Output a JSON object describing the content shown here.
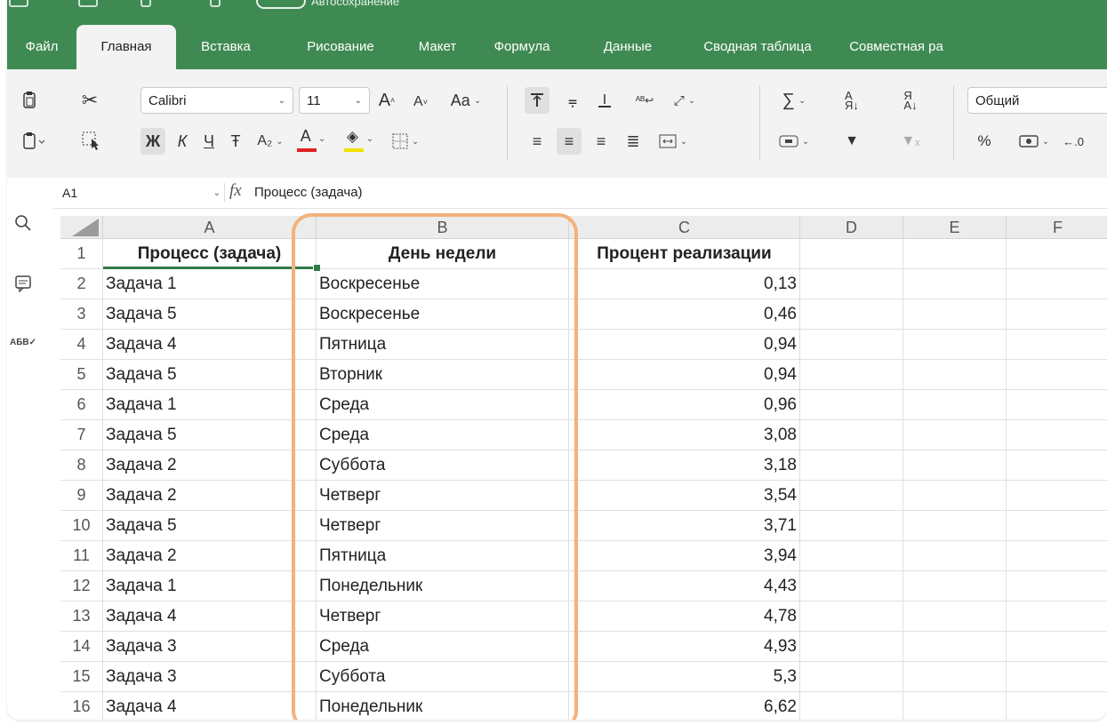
{
  "title_bar": {
    "autosave_label": "Автосохранение"
  },
  "ribbon_tabs": [
    {
      "label": "Файл",
      "active": false
    },
    {
      "label": "Главная",
      "active": true
    },
    {
      "label": "Вставка",
      "active": false
    },
    {
      "label": "Рисование",
      "active": false
    },
    {
      "label": "Макет",
      "active": false
    },
    {
      "label": "Формула",
      "active": false
    },
    {
      "label": "Данные",
      "active": false
    },
    {
      "label": "Сводная таблица",
      "active": false
    },
    {
      "label": "Совместная ра",
      "active": false
    }
  ],
  "ribbon": {
    "font_name": "Calibri",
    "font_size": "11",
    "bold_label": "Ж",
    "italic_label": "К",
    "underline_label": "Ч",
    "number_format": "Общий",
    "percent_label": "%",
    "font_color": "#e02020",
    "fill_color": "#f2e200"
  },
  "formula_bar": {
    "name_box": "A1",
    "fx_label": "fx",
    "value": "Процесс (задача)"
  },
  "grid": {
    "columns": [
      "A",
      "B",
      "C",
      "D",
      "E",
      "F"
    ],
    "header_row": {
      "num": "1",
      "a": "Процесс (задача)",
      "b": "День недели",
      "c": "Процент реализации"
    },
    "rows": [
      {
        "num": "2",
        "a": "Задача 1",
        "b": "Воскресенье",
        "c": "0,13"
      },
      {
        "num": "3",
        "a": "Задача 5",
        "b": "Воскресенье",
        "c": "0,46"
      },
      {
        "num": "4",
        "a": "Задача 4",
        "b": "Пятница",
        "c": "0,94"
      },
      {
        "num": "5",
        "a": "Задача 5",
        "b": "Вторник",
        "c": "0,94"
      },
      {
        "num": "6",
        "a": "Задача 1",
        "b": "Среда",
        "c": "0,96"
      },
      {
        "num": "7",
        "a": "Задача 5",
        "b": "Среда",
        "c": "3,08"
      },
      {
        "num": "8",
        "a": "Задача 2",
        "b": "Суббота",
        "c": "3,18"
      },
      {
        "num": "9",
        "a": "Задача 2",
        "b": "Четверг",
        "c": "3,54"
      },
      {
        "num": "10",
        "a": "Задача 5",
        "b": "Четверг",
        "c": "3,71"
      },
      {
        "num": "11",
        "a": "Задача 2",
        "b": "Пятница",
        "c": "3,94"
      },
      {
        "num": "12",
        "a": "Задача 1",
        "b": "Понедельник",
        "c": "4,43"
      },
      {
        "num": "13",
        "a": "Задача 4",
        "b": "Четверг",
        "c": "4,78"
      },
      {
        "num": "14",
        "a": "Задача 3",
        "b": "Среда",
        "c": "4,93"
      },
      {
        "num": "15",
        "a": "Задача 3",
        "b": "Суббота",
        "c": "5,3"
      },
      {
        "num": "16",
        "a": "Задача 4",
        "b": "Понедельник",
        "c": "6,62"
      }
    ]
  },
  "colors": {
    "ribbon_green": "#3f8a52",
    "selection": "#2f7a45",
    "highlight": "#f3b27a"
  }
}
